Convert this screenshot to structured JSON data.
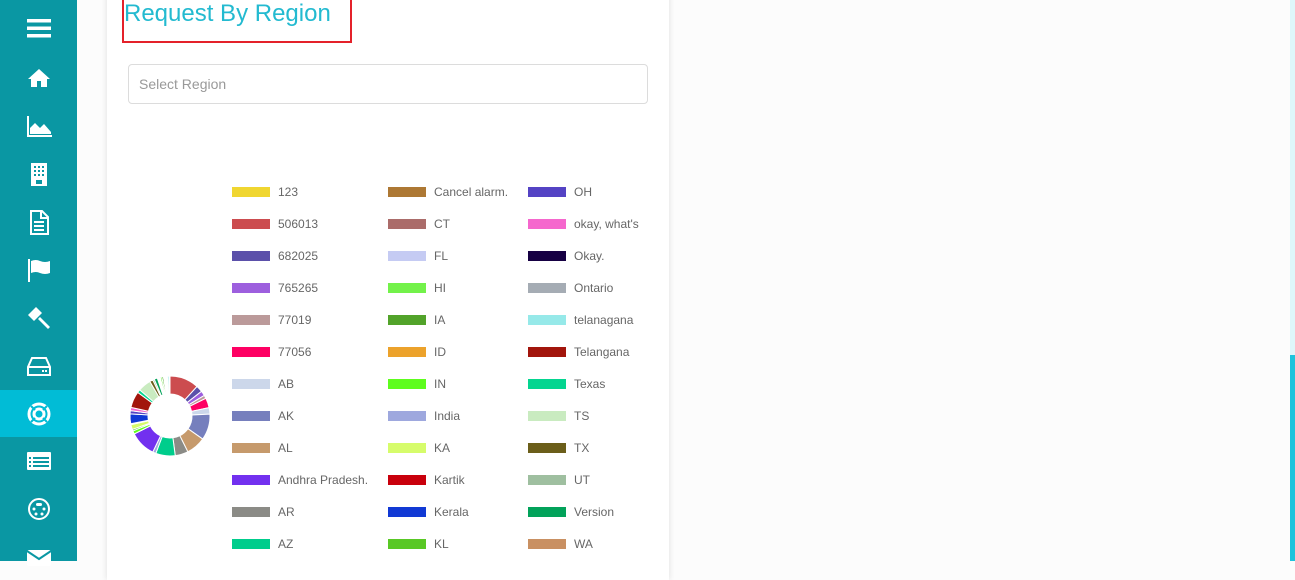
{
  "sidebar": {
    "items": [
      {
        "icon": "menu-icon"
      },
      {
        "icon": "home-icon"
      },
      {
        "icon": "area-chart-icon"
      },
      {
        "icon": "building-icon"
      },
      {
        "icon": "document-icon"
      },
      {
        "icon": "flag-icon"
      },
      {
        "icon": "gavel-icon"
      },
      {
        "icon": "hard-drive-icon"
      },
      {
        "icon": "life-ring-icon",
        "active": true
      },
      {
        "icon": "list-icon"
      },
      {
        "icon": "connector-icon"
      },
      {
        "icon": "envelope-icon"
      }
    ]
  },
  "card": {
    "title": "Request By Region",
    "select_placeholder": "Select Region"
  },
  "colors": {
    "sidebar": "#0a97a3",
    "sidebar_active": "#01bcd6",
    "title": "#23bad0",
    "highlight_box": "#e4212a"
  },
  "chart_data": {
    "type": "pie",
    "variant": "donut",
    "title": "Request By Region",
    "legend_position": "right",
    "categories": [
      "123",
      "506013",
      "682025",
      "765265",
      "77019",
      "77056",
      "AB",
      "AK",
      "AL",
      "Andhra Pradesh.",
      "AR",
      "AZ",
      "Cancel alarm.",
      "CT",
      "FL",
      "HI",
      "IA",
      "ID",
      "IN",
      "India",
      "KA",
      "Kartik",
      "Kerala",
      "KL",
      "OH",
      "okay, what's",
      "Okay.",
      "Ontario",
      "telanagana",
      "Telangana",
      "Texas",
      "TS",
      "TX",
      "UT",
      "Version",
      "WA"
    ],
    "colors": [
      "#f0d631",
      "#cc4c4f",
      "#5b50aa",
      "#9d5fde",
      "#bb9a9a",
      "#fe0063",
      "#ccd7ea",
      "#767fbd",
      "#c69a6c",
      "#7230ef",
      "#8b8b86",
      "#00cd8c",
      "#ad7834",
      "#ab6c6a",
      "#c5cbf3",
      "#73f24a",
      "#52a32a",
      "#eca22b",
      "#5efd1e",
      "#9ea8de",
      "#d6fc6b",
      "#c9000c",
      "#1139d4",
      "#59c825",
      "#5443c4",
      "#f567cd",
      "#160043",
      "#a5acb4",
      "#96e9e9",
      "#a2150c",
      "#04d590",
      "#c9ebc0",
      "#6b5e1a",
      "#9fbfa0",
      "#02a25a",
      "#c99062"
    ],
    "values": [
      0.3,
      9,
      2,
      1.5,
      1,
      3,
      2,
      8,
      6,
      1.5,
      4,
      6,
      0.3,
      0.3,
      0.3,
      0.5,
      0.5,
      0.3,
      1,
      1,
      1.5,
      0.3,
      3,
      0.5,
      1,
      1,
      0.3,
      0.3,
      0.5,
      5,
      1,
      4,
      1,
      0.5,
      1,
      0.3
    ],
    "slice_order": [
      "506013",
      "682025",
      "765265",
      "77019",
      "77056",
      "AB",
      "AK",
      "AL",
      "AR",
      "AZ",
      "India",
      "Andhra Pradesh.",
      "IN",
      "KL",
      "KA",
      "FL",
      "Kerala",
      "OH",
      "okay, what's",
      "Telangana",
      "Texas",
      "TS",
      "TX",
      "UT",
      "Version",
      "123",
      "Cancel alarm.",
      "CT",
      "HI",
      "IA",
      "ID",
      "Kartik",
      "Okay.",
      "Ontario",
      "telanagana",
      "WA"
    ],
    "slice_values": [
      9,
      2,
      1.5,
      1,
      3,
      2,
      8,
      6,
      4,
      6,
      1,
      8,
      1,
      0.5,
      1.5,
      0.3,
      3,
      1,
      1,
      5,
      1,
      4,
      1,
      0.5,
      1,
      0.3,
      0.3,
      0.3,
      0.5,
      0.5,
      0.3,
      0.3,
      0.3,
      0.3,
      0.5,
      0.3
    ]
  }
}
